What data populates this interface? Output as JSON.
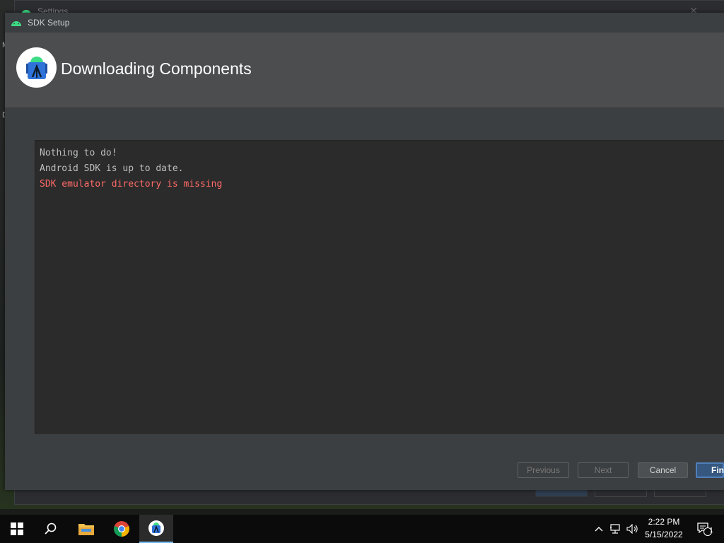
{
  "background_window": {
    "title": "Settings",
    "side_chars": [
      "M",
      "D"
    ]
  },
  "dialog": {
    "title": "SDK Setup",
    "header_title": "Downloading Components",
    "console_lines": [
      {
        "text": "Nothing to do!",
        "type": "info"
      },
      {
        "text": "Android SDK is up to date.",
        "type": "info"
      },
      {
        "text": "SDK emulator directory is missing",
        "type": "error"
      }
    ],
    "buttons": {
      "previous": "Previous",
      "next": "Next",
      "cancel": "Cancel",
      "finish": "Fini"
    }
  },
  "colors": {
    "android_green": "#3ddc84",
    "error_text": "#ff6b68",
    "primary_button": "#365880"
  },
  "taskbar": {
    "apps": [
      {
        "name": "start-button",
        "icon": "windows-logo-icon"
      },
      {
        "name": "search-button",
        "icon": "search-icon"
      },
      {
        "name": "file-explorer",
        "icon": "folder-icon"
      },
      {
        "name": "chrome",
        "icon": "chrome-icon"
      },
      {
        "name": "android-studio",
        "icon": "android-studio-icon",
        "active": true
      }
    ],
    "clock": {
      "time": "2:22 PM",
      "date": "5/15/2022"
    },
    "notification_count": "1"
  }
}
